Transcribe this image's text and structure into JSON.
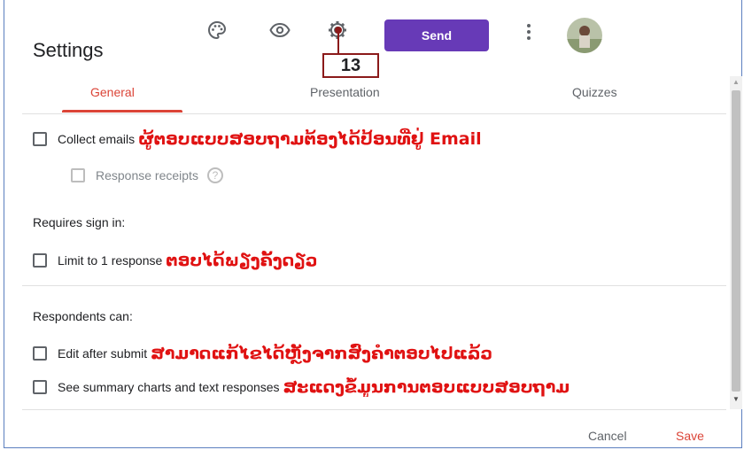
{
  "toolbar": {
    "icons": [
      "palette-icon",
      "eye-icon",
      "gear-icon"
    ],
    "send_label": "Send"
  },
  "dialog": {
    "title": "Settings",
    "callout_number": "13",
    "tabs": [
      {
        "label": "General",
        "active": true
      },
      {
        "label": "Presentation",
        "active": false
      },
      {
        "label": "Quizzes",
        "active": false
      }
    ],
    "options": {
      "collect_emails": {
        "label": "Collect emails",
        "note": "ຜູ້ຕອບແບບສອບຖາມຕ້ອງໄດ້ປ້ອນທີ່ຢູ່ Email"
      },
      "response_receipts": {
        "label": "Response receipts",
        "help": "?"
      },
      "requires_sign_in": "Requires sign in:",
      "limit_response": {
        "label": "Limit to 1 response",
        "note": "ຕອບໄດ້ພຽງຄັ້ງດຽວ"
      },
      "respondents_can": "Respondents can:",
      "edit_after_submit": {
        "label": "Edit after submit",
        "note": "ສາມາດແກ້ໄຂໄດ້ຫຼັງຈາກສົ່ງຄຳຕອບໄປແລ້ວ"
      },
      "see_summary": {
        "label": "See summary charts and text responses",
        "note": "ສະແດງຂໍ້ມູນການຕອບແບບສອບຖາມ"
      }
    },
    "footer": {
      "cancel_label": "Cancel",
      "save_label": "Save"
    }
  },
  "colors": {
    "accent": "#673ab7",
    "tab_active": "#db4437",
    "note": "#e01212",
    "callout": "#8b1a1a"
  }
}
